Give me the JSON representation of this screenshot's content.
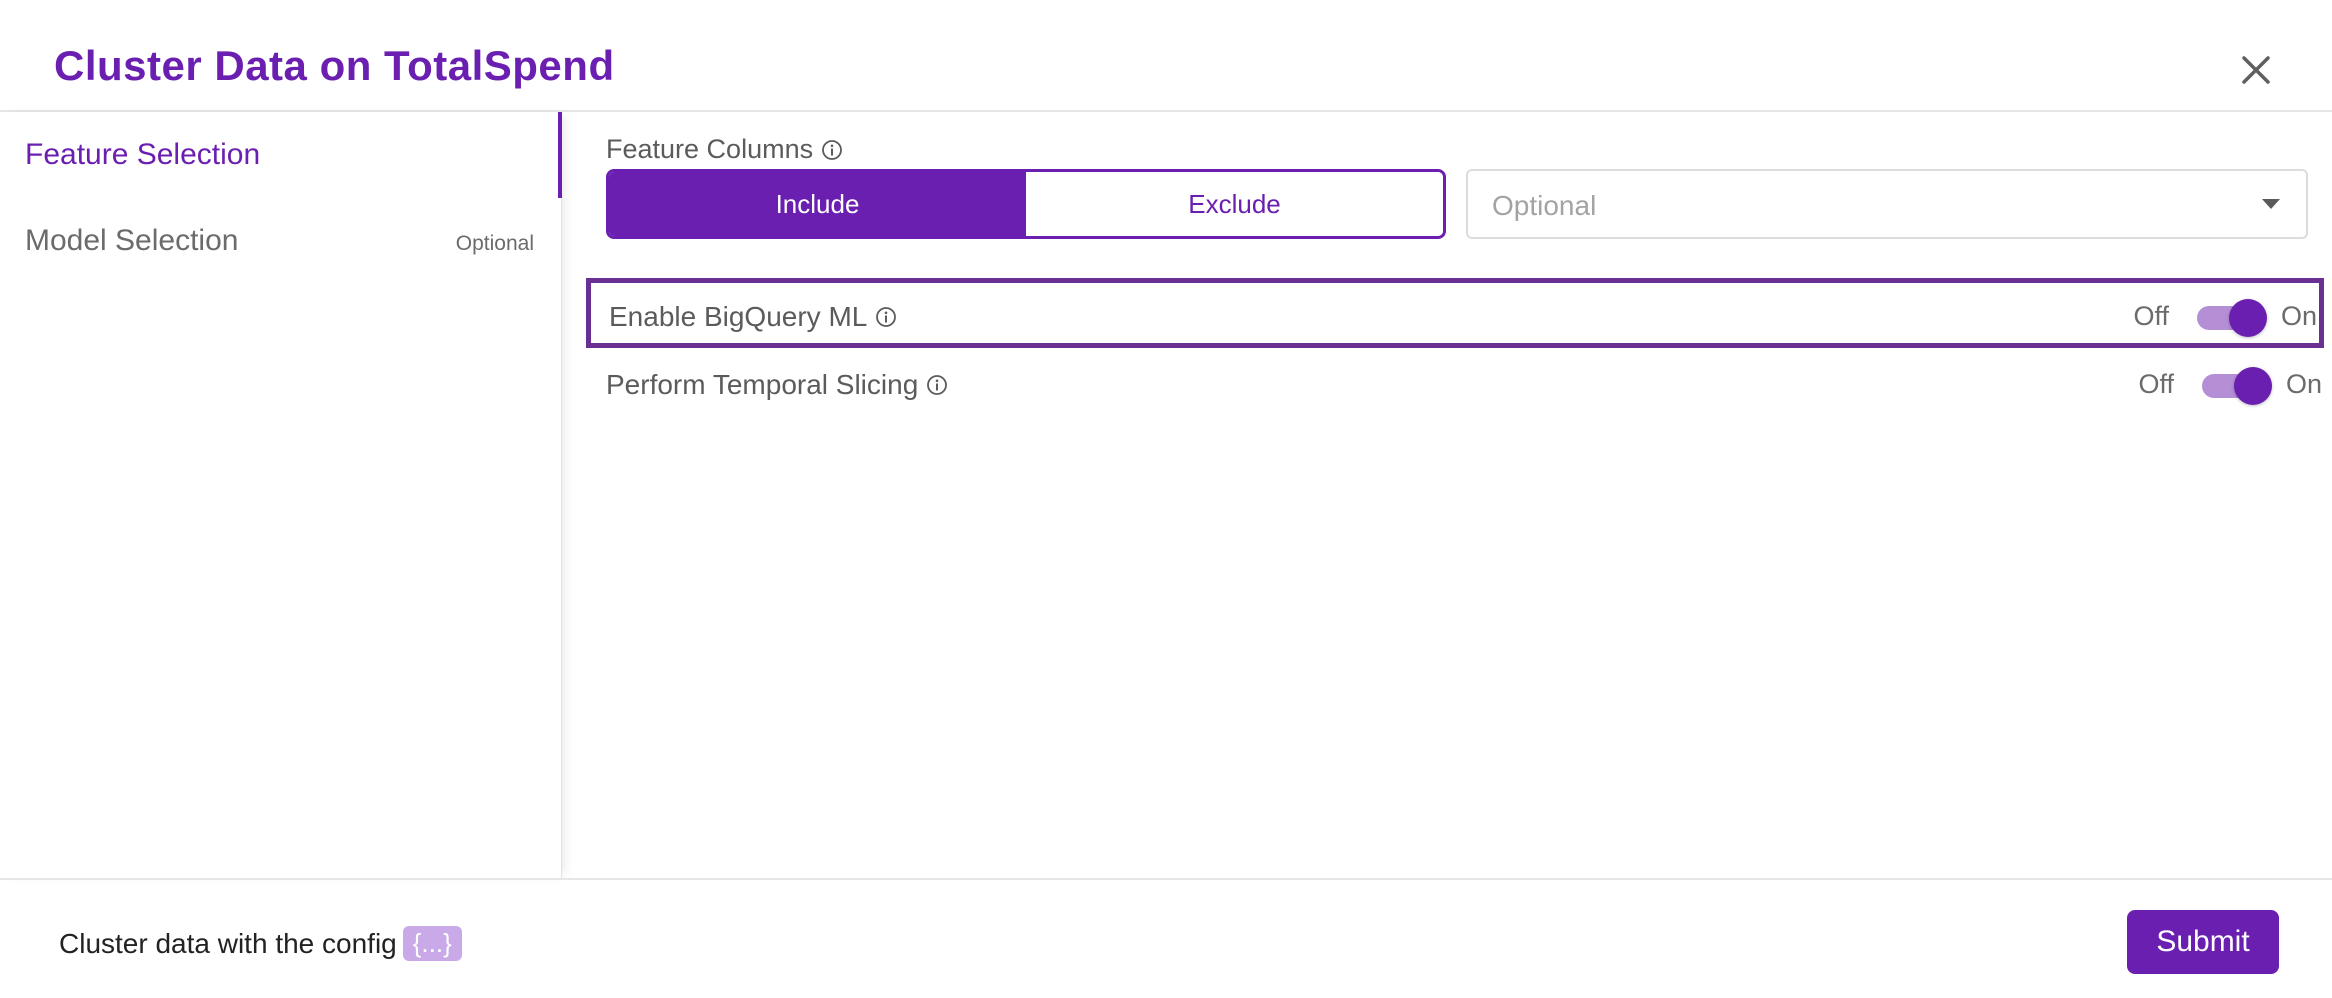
{
  "header": {
    "title": "Cluster Data on TotalSpend",
    "close_icon": "close-icon"
  },
  "sidebar": {
    "items": [
      {
        "label": "Feature Selection",
        "tag": "",
        "active": true
      },
      {
        "label": "Model Selection",
        "tag": "Optional",
        "active": false
      }
    ]
  },
  "main": {
    "feature_columns": {
      "label": "Feature Columns",
      "include_label": "Include",
      "exclude_label": "Exclude",
      "selected_mode": "Include",
      "select_placeholder": "Optional"
    },
    "toggles": [
      {
        "label": "Enable BigQuery ML",
        "off_label": "Off",
        "on_label": "On",
        "value": "On"
      },
      {
        "label": "Perform Temporal Slicing",
        "off_label": "Off",
        "on_label": "On",
        "value": "On"
      }
    ]
  },
  "footer": {
    "text": "Cluster data with the config",
    "config_chip": "{...}",
    "submit_label": "Submit"
  },
  "colors": {
    "accent": "#6b1fb1",
    "toggle_track": "#b48fd6",
    "highlight_border": "#6b2f91",
    "chip": "#c9a9e8"
  }
}
